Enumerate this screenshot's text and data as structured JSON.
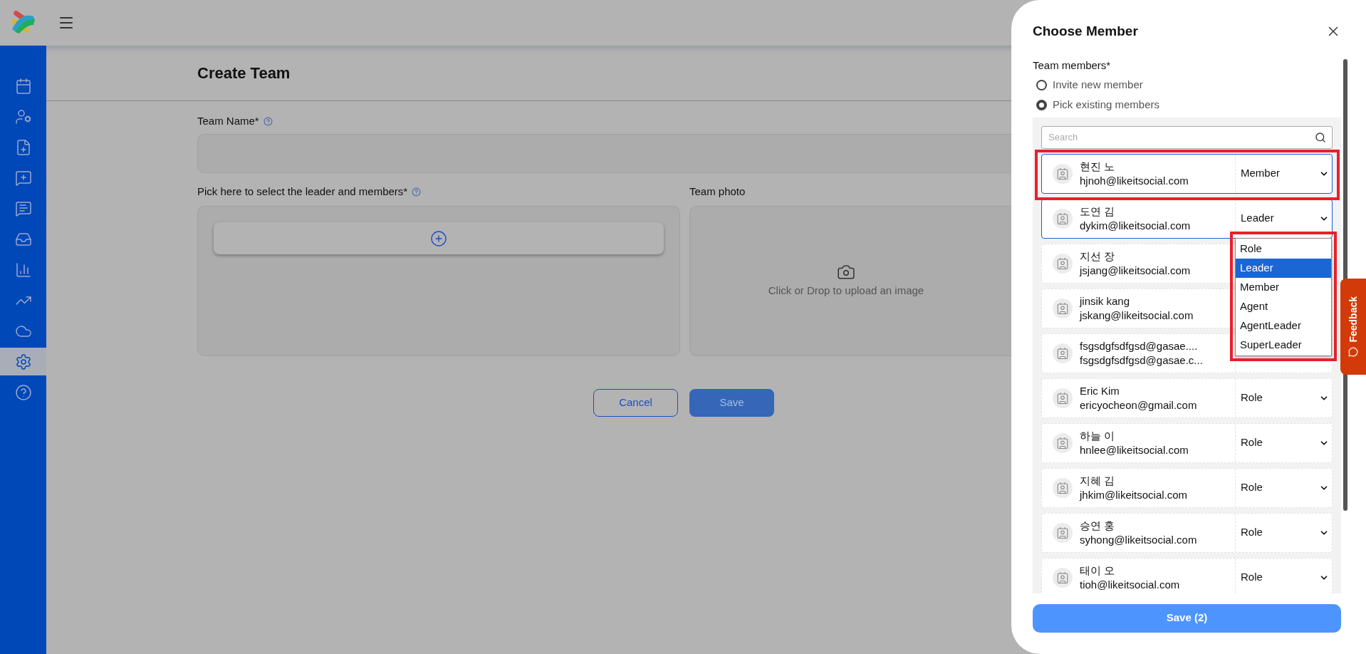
{
  "sidebar": {
    "items": [
      {
        "selected": false
      },
      {
        "selected": false
      },
      {
        "selected": false
      },
      {
        "selected": false
      },
      {
        "selected": false
      },
      {
        "selected": false
      },
      {
        "selected": false
      },
      {
        "selected": false
      },
      {
        "selected": false
      },
      {
        "selected": true
      },
      {
        "selected": false
      }
    ]
  },
  "page": {
    "title": "Create Team",
    "team_name_label": "Team Name*",
    "members_label": "Pick here to select the leader and members*",
    "photo_label": "Team photo",
    "photo_hint": "Click or Drop to upload an image",
    "cancel": "Cancel",
    "save": "Save"
  },
  "drawer": {
    "title": "Choose Member",
    "members_label": "Team members*",
    "options": [
      {
        "label": "Invite new member",
        "selected": false
      },
      {
        "label": "Pick existing members",
        "selected": true
      }
    ],
    "search": {
      "placeholder": "Search"
    },
    "members": [
      {
        "name": "현진 노",
        "email": "hjnoh@likeitsocial.com",
        "role": "Member",
        "selected": true
      },
      {
        "name": "도연 김",
        "email": "dykim@likeitsocial.com",
        "role": "Leader",
        "selected": true,
        "menu": [
          {
            "label": "Role",
            "selected": false
          },
          {
            "label": "Leader",
            "selected": true
          },
          {
            "label": "Member",
            "selected": false
          },
          {
            "label": "Agent",
            "selected": false
          },
          {
            "label": "AgentLeader",
            "selected": false
          },
          {
            "label": "SuperLeader",
            "selected": false
          }
        ]
      },
      {
        "name": "지선 장",
        "email": "jsjang@likeitsocial.com",
        "selected": false
      },
      {
        "name": "jinsik kang",
        "email": "jskang@likeitsocial.com",
        "selected": false
      },
      {
        "name": "fsgsdgfsdfgsd@gasae....",
        "email": "fsgsdgfsdfgsd@gasae.c...",
        "selected": false
      },
      {
        "name": "Eric Kim",
        "email": "ericyocheon@gmail.com",
        "role": "Role",
        "selected": false
      },
      {
        "name": "하늘 이",
        "email": "hnlee@likeitsocial.com",
        "role": "Role",
        "selected": false
      },
      {
        "name": "지혜 김",
        "email": "jhkim@likeitsocial.com",
        "role": "Role",
        "selected": false
      },
      {
        "name": "승연 홍",
        "email": "syhong@likeitsocial.com",
        "role": "Role",
        "selected": false
      },
      {
        "name": "태이 오",
        "email": "tioh@likeitsocial.com",
        "role": "Role",
        "selected": false
      }
    ],
    "save": "Save (2)"
  },
  "feedback": {
    "label": "Feedback"
  }
}
